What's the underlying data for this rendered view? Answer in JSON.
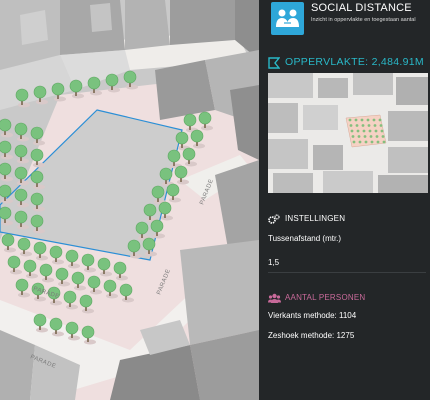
{
  "app": {
    "title": "SOCIAL DISTANCE",
    "subtitle": "Inzicht in oppervlakte en toegestaan aantal",
    "accent_color": "#29b8c8",
    "logo_color": "#2ea7d9",
    "logo_icon": "two-people-icon"
  },
  "area": {
    "label": "OPPERVLAKTE: 2,484.91M",
    "icon": "polygon-area-icon"
  },
  "settings": {
    "header": "INSTELLINGEN",
    "icon": "gears-icon",
    "distance_label": "Tussenafstand (mtr.)",
    "distance_value": "1,5"
  },
  "persons": {
    "header": "AANTAL PERSONEN",
    "icon": "users-icon",
    "header_color": "#c86a9a",
    "square_method": "Vierkants methode: 1104",
    "hex_method": "Zeshoek methode: 1275"
  },
  "map": {
    "streets": [
      "PARADE",
      "PARADE",
      "PARADE",
      "PARADE"
    ],
    "selection_color": "#2b8fd6"
  }
}
